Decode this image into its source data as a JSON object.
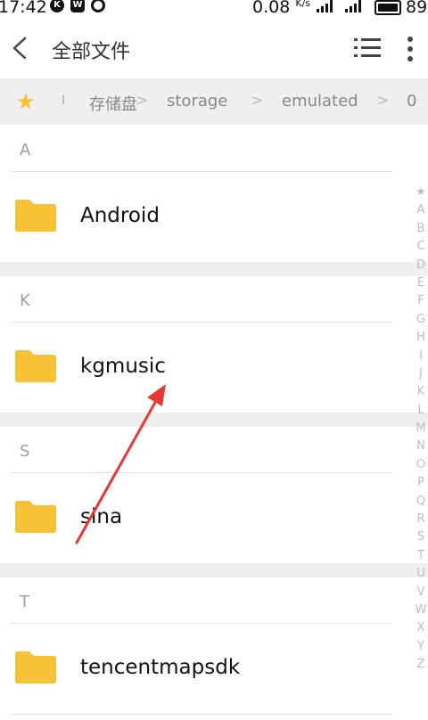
{
  "status": {
    "time": "17:42",
    "speed": "0.08",
    "speed_unit": "K/s",
    "battery": "89",
    "app_icons": [
      "k-app-icon",
      "w-app-icon",
      "radar-icon"
    ]
  },
  "header": {
    "title": "全部文件",
    "back_icon": "chevron-left-icon",
    "view_icon": "list-view-icon",
    "more_icon": "more-vertical-icon"
  },
  "breadcrumb": {
    "separator": "I",
    "items": [
      "存储盘",
      "storage",
      "emulated",
      "0"
    ],
    "arrow": ">"
  },
  "sections": [
    {
      "letter": "A",
      "files": [
        "Android"
      ]
    },
    {
      "letter": "K",
      "files": [
        "kgmusic"
      ]
    },
    {
      "letter": "S",
      "files": [
        "sina"
      ]
    },
    {
      "letter": "T",
      "files": [
        "tencentmapsdk"
      ]
    }
  ],
  "index": [
    "★",
    "A",
    "B",
    "C",
    "D",
    "E",
    "F",
    "G",
    "H",
    "I",
    "J",
    "K",
    "L",
    "M",
    "N",
    "O",
    "P",
    "Q",
    "R",
    "S",
    "T",
    "U",
    "V",
    "W",
    "X",
    "Y",
    "Z"
  ],
  "colors": {
    "folder": "#f8c237",
    "star": "#f5c22e",
    "annotation_arrow": "#e53935"
  }
}
